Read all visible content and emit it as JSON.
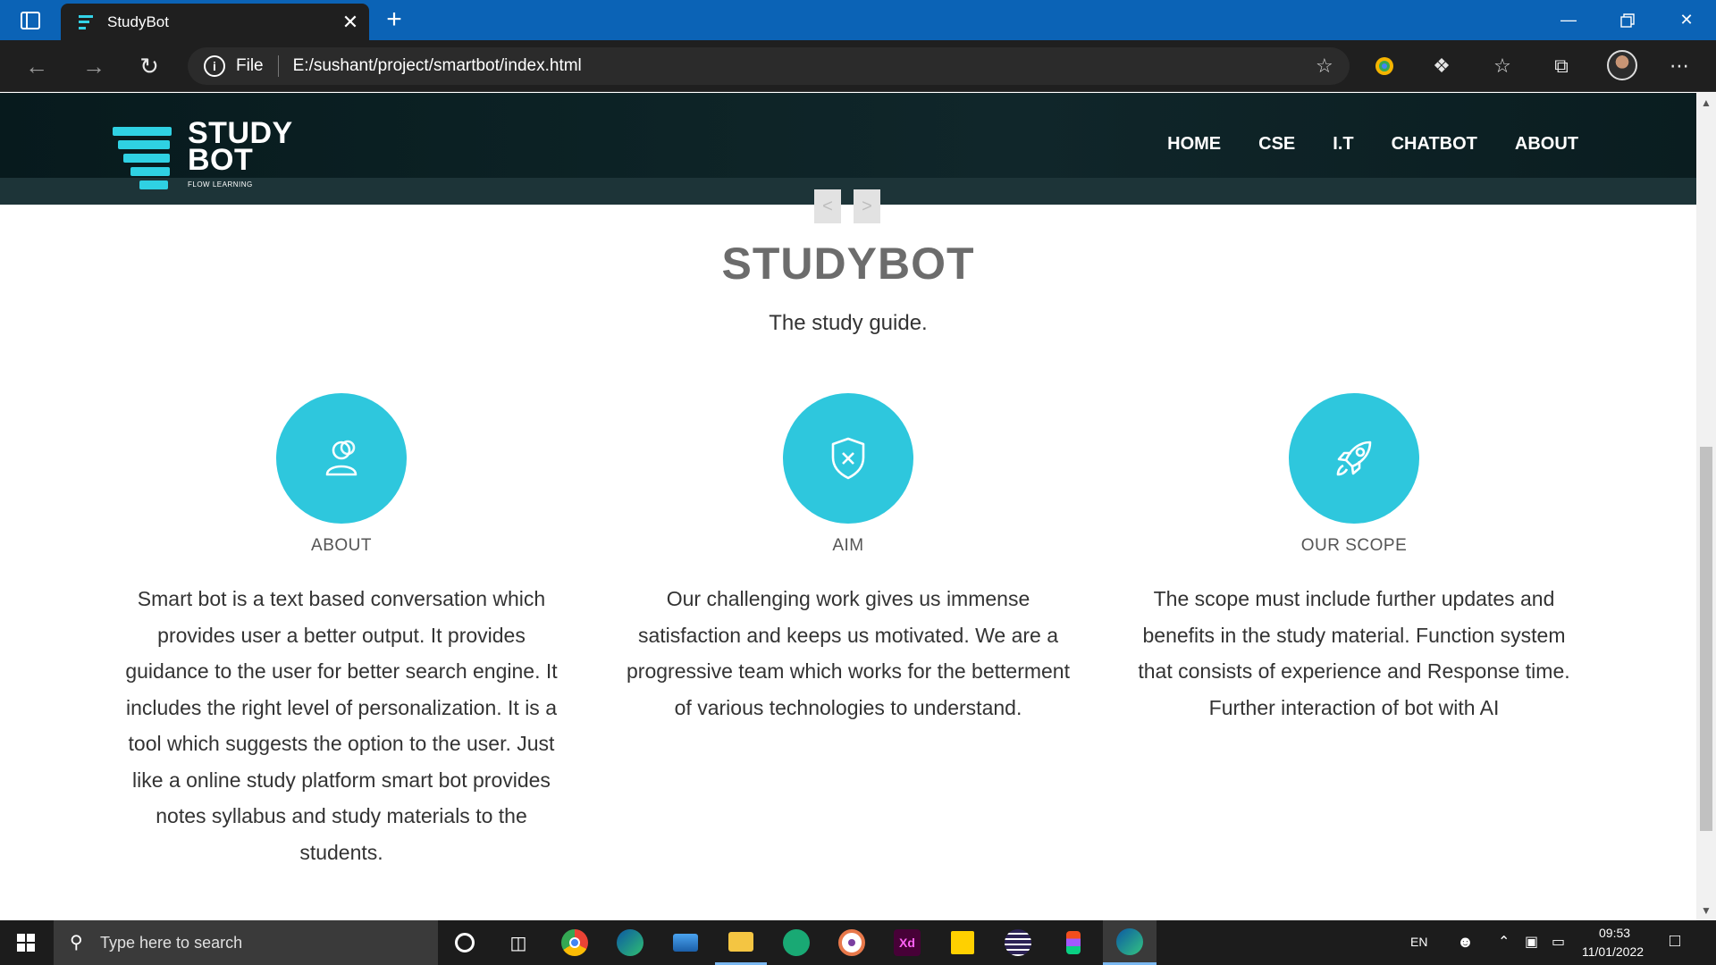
{
  "browser": {
    "tab_title": "StudyBot",
    "address_scheme": "File",
    "address_url": "E:/sushant/project/smartbot/index.html"
  },
  "site": {
    "logo_line1": "STUDY",
    "logo_line2": "BOT",
    "logo_tagline": "FLOW LEARNING",
    "nav": [
      "HOME",
      "CSE",
      "I.T",
      "CHATBOT",
      "ABOUT"
    ],
    "slider_prev": "<",
    "slider_next": ">",
    "hero_title": "STUDYBOT",
    "hero_subtitle": "The study guide.",
    "features": [
      {
        "icon": "user-icon",
        "heading": "ABOUT",
        "text": "Smart bot is a text based conversation which provides user a better output. It provides guidance to the user for better search engine. It includes the right level of personalization. It is a tool which suggests the option to the user. Just like a online study platform smart bot provides notes syllabus and study materials to the students."
      },
      {
        "icon": "shield-icon",
        "heading": "AIM",
        "text": "Our challenging work gives us immense satisfaction and keeps us motivated. We are a progressive team which works for the betterment of various technologies to understand."
      },
      {
        "icon": "rocket-icon",
        "heading": "OUR SCOPE",
        "text": "The scope must include further updates and benefits in the study material. Function system that consists of experience and Response time. Further interaction of bot with AI"
      }
    ],
    "accent_color": "#2ec7dd"
  },
  "taskbar": {
    "search_placeholder": "Type here to search",
    "language": "EN",
    "time": "09:53",
    "date": "11/01/2022",
    "apps": [
      "cortana-icon",
      "task-view-icon",
      "chrome-icon",
      "edge-dev-icon",
      "laptop-app-icon",
      "file-explorer-icon",
      "gitkraken-icon",
      "media-player-icon",
      "adobe-xd-icon",
      "sticky-notes-icon",
      "eclipse-icon",
      "figma-icon",
      "edge-icon"
    ]
  }
}
